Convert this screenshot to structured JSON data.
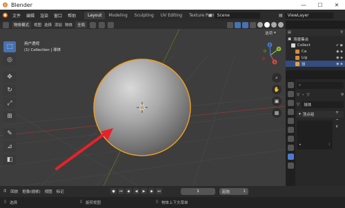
{
  "window": {
    "title": "Blender",
    "buttons": [
      "—",
      "☐",
      "✕"
    ]
  },
  "menubar": {
    "items": [
      "文件",
      "编辑",
      "渲染",
      "窗口",
      "帮助"
    ],
    "workspaces": [
      "Layout",
      "Modeling",
      "Sculpting",
      "UV Editing",
      "Texture Paint"
    ],
    "active_workspace": "Layout",
    "scene": "Scene",
    "view_layer": "ViewLayer"
  },
  "viewport_header": {
    "mode": "物体模式",
    "menus": [
      "视图",
      "选择",
      "添加",
      "物体"
    ],
    "orientation": "全局",
    "options_label": "选项"
  },
  "viewport": {
    "view_name": "用户透视",
    "collection_info": "(1) Collection | 球体",
    "gizmo_labels": {
      "y": "Y",
      "z": "Z",
      "x": "X"
    }
  },
  "outliner": {
    "header": "场景集合",
    "items": [
      {
        "label": "Collect",
        "selected": false,
        "color": "#d9d9d9"
      },
      {
        "label": "Ca",
        "selected": false,
        "color": "#d88a3f"
      },
      {
        "label": "Lig",
        "selected": false,
        "color": "#d88a3f"
      },
      {
        "label": "球",
        "selected": true,
        "color": "#e8a23a"
      }
    ]
  },
  "properties": {
    "object_name": "球体",
    "section": "顶点组",
    "vg_buttons": [
      "+",
      "−",
      "∨"
    ]
  },
  "timeline": {
    "menus": [
      "回放",
      "抠像(插帧)",
      "视图",
      "标记"
    ],
    "current_frame": "1",
    "start_label": "起始",
    "start_value": "1"
  },
  "statusbar": {
    "items": [
      "选择",
      "旋转视图",
      "物体上下文菜单"
    ]
  },
  "colors": {
    "accent": "#4772b3",
    "selection_outline": "#f29d1b",
    "arrow": "#e8212a"
  }
}
